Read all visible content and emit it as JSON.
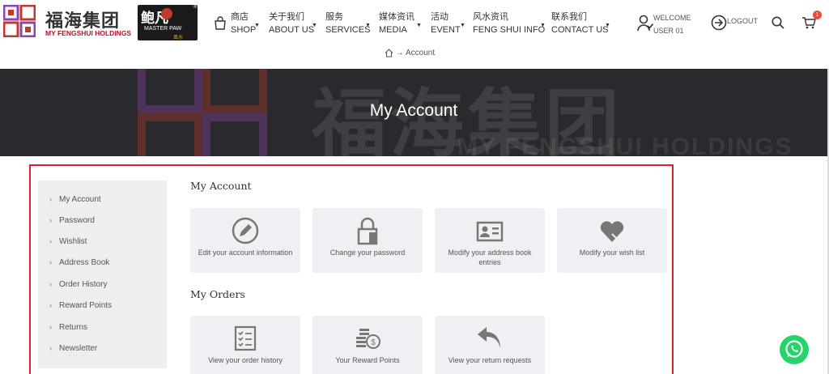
{
  "brand": {
    "logo_cn": "福海集团",
    "logo_en": "MY FENGSHUI HOLDINGS",
    "partner_cn": "鲍凡",
    "partner_en": "MASTER PAW",
    "partner_sub": "風水",
    "partner_reg": "®"
  },
  "nav": {
    "items": [
      {
        "cn": "商店",
        "en": "SHOP"
      },
      {
        "cn": "关于我们",
        "en": "ABOUT US"
      },
      {
        "cn": "服务",
        "en": "SERVICES"
      },
      {
        "cn": "媒体资讯",
        "en": "MEDIA"
      },
      {
        "cn": "活动",
        "en": "EVENT"
      },
      {
        "cn": "风水资讯",
        "en": "FENG SHUI INFO"
      },
      {
        "cn": "联系我们",
        "en": "CONTACT US"
      }
    ]
  },
  "user": {
    "welcome_line1": "WELCOME",
    "welcome_line2": "USER 01",
    "logout_label": "LOGOUT",
    "cart_count": "1"
  },
  "breadcrumb": {
    "arrow": "→",
    "current": "Account"
  },
  "banner": {
    "title": "My Account",
    "bg_cn": "福海集团",
    "bg_en": "MY FENGSHUI HOLDINGS"
  },
  "sidebar": {
    "items": [
      {
        "label": "My Account"
      },
      {
        "label": "Password"
      },
      {
        "label": "Wishlist"
      },
      {
        "label": "Address Book"
      },
      {
        "label": "Order History"
      },
      {
        "label": "Reward Points"
      },
      {
        "label": "Returns"
      },
      {
        "label": "Newsletter"
      }
    ]
  },
  "account_section": {
    "title": "My Account",
    "cards": [
      {
        "label": "Edit your account information",
        "icon": "edit-pencil-icon"
      },
      {
        "label": "Change your password",
        "icon": "lock-icon"
      },
      {
        "label": "Modify your address book entries",
        "icon": "address-card-icon"
      },
      {
        "label": "Modify your wish list",
        "icon": "heart-icon"
      }
    ]
  },
  "orders_section": {
    "title": "My Orders",
    "cards": [
      {
        "label": "View your order history",
        "icon": "checklist-icon"
      },
      {
        "label": "Your Reward Points",
        "icon": "coins-icon"
      },
      {
        "label": "View your return requests",
        "icon": "return-arrow-icon"
      }
    ]
  },
  "colors": {
    "accent_red": "#d62332",
    "card_bg": "#eef0f4",
    "sidebar_bg": "#eeeeee",
    "whatsapp_green": "#25d366",
    "icon_gray": "#777777"
  }
}
